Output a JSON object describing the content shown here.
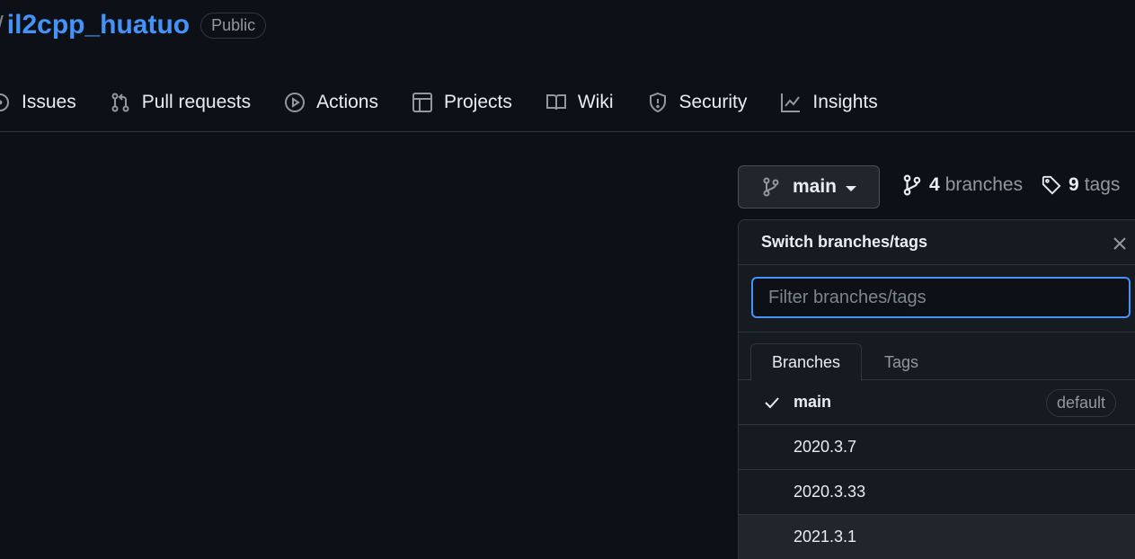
{
  "repo": {
    "slash": "/",
    "name": "il2cpp_huatuo",
    "visibility": "Public"
  },
  "nav": [
    {
      "label": "Issues",
      "icon": "issue-opened-icon"
    },
    {
      "label": "Pull requests",
      "icon": "git-pull-request-icon"
    },
    {
      "label": "Actions",
      "icon": "play-icon"
    },
    {
      "label": "Projects",
      "icon": "table-icon"
    },
    {
      "label": "Wiki",
      "icon": "book-icon"
    },
    {
      "label": "Security",
      "icon": "shield-icon"
    },
    {
      "label": "Insights",
      "icon": "graph-icon"
    }
  ],
  "branch_button": {
    "label": "main"
  },
  "branches_count": {
    "count": "4",
    "label": "branches"
  },
  "tags_count": {
    "count": "9",
    "label": "tags"
  },
  "dropdown": {
    "title": "Switch branches/tags",
    "filter_placeholder": "Filter branches/tags",
    "filter_value": "",
    "tabs": [
      "Branches",
      "Tags"
    ],
    "branches": [
      {
        "name": "main",
        "selected": true,
        "badge": "default"
      },
      {
        "name": "2020.3.7"
      },
      {
        "name": "2020.3.33"
      },
      {
        "name": "2021.3.1"
      }
    ]
  },
  "colors": {
    "background": "#0d1117",
    "link": "#4493f8",
    "border": "#30363d",
    "focus": "#4493f8"
  }
}
